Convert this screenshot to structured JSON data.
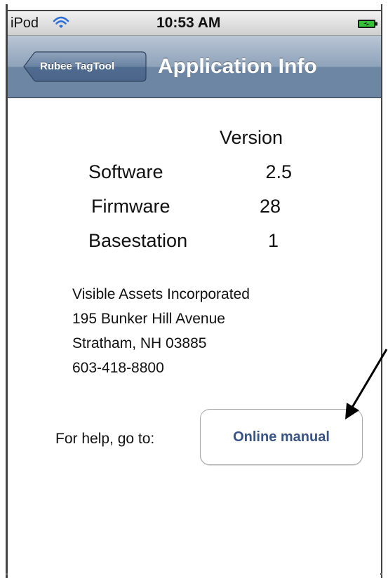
{
  "status_bar": {
    "carrier": "iPod",
    "time": "10:53 AM",
    "wifi_icon": "wifi-icon",
    "battery_icon": "battery-charging-icon"
  },
  "nav": {
    "back_label": "Rubee TagTool",
    "title": "Application Info"
  },
  "version_table": {
    "header": "Version",
    "rows": [
      {
        "label": "Software",
        "value": "2.5"
      },
      {
        "label": "Firmware",
        "value": "28"
      },
      {
        "label": "Basestation",
        "value": "1"
      }
    ]
  },
  "address": {
    "lines": [
      "Visible Assets Incorporated",
      "195 Bunker Hill Avenue",
      "Stratham, NH 03885",
      "603-418-8800"
    ]
  },
  "help": {
    "label": "For help, go to:",
    "button_label": "Online manual"
  },
  "colors": {
    "nav_bar": "#6d86a3",
    "button_text": "#385487"
  }
}
